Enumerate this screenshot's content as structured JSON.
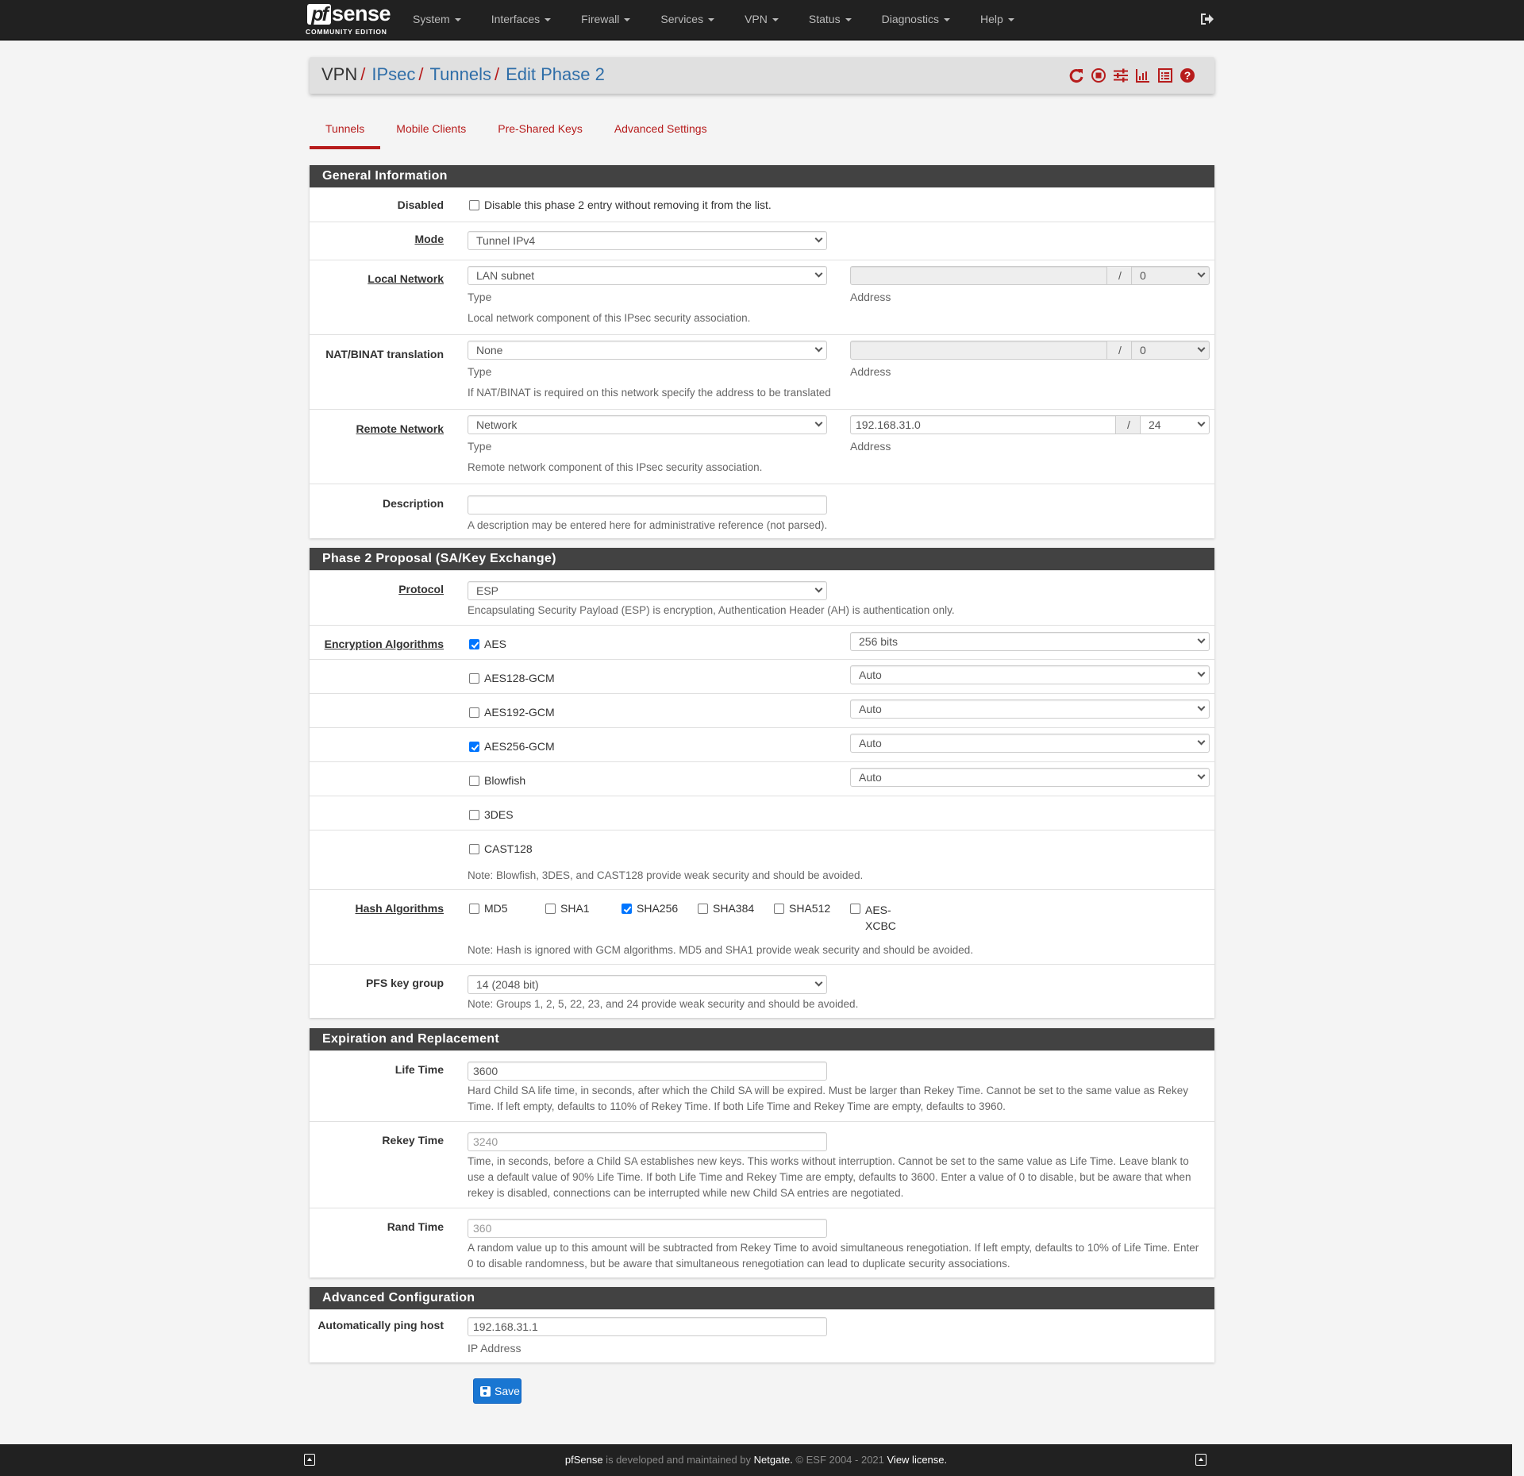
{
  "brand": {
    "logo_pf": "pf",
    "logo_sense": "sense",
    "edition": "COMMUNITY EDITION"
  },
  "nav": {
    "items": [
      {
        "label": "System"
      },
      {
        "label": "Interfaces"
      },
      {
        "label": "Firewall"
      },
      {
        "label": "Services"
      },
      {
        "label": "VPN"
      },
      {
        "label": "Status"
      },
      {
        "label": "Diagnostics"
      },
      {
        "label": "Help"
      }
    ],
    "logout_icon": "sign-out-icon"
  },
  "breadcrumb": {
    "items": [
      {
        "label": "VPN",
        "link": false
      },
      {
        "label": "IPsec",
        "link": true
      },
      {
        "label": "Tunnels",
        "link": true
      },
      {
        "label": "Edit Phase 2",
        "link": true
      }
    ],
    "separator": "/",
    "icons": [
      "refresh-icon",
      "stop-circle-icon",
      "sliders-icon",
      "bar-chart-icon",
      "list-icon",
      "help-circle-icon"
    ]
  },
  "tabs": [
    {
      "label": "Tunnels",
      "active": true
    },
    {
      "label": "Mobile Clients",
      "active": false
    },
    {
      "label": "Pre-Shared Keys",
      "active": false
    },
    {
      "label": "Advanced Settings",
      "active": false
    }
  ],
  "general": {
    "heading": "General Information",
    "disabled": {
      "label": "Disabled",
      "checked": false,
      "text": "Disable this phase 2 entry without removing it from the list."
    },
    "mode": {
      "label": "Mode",
      "value": "Tunnel IPv4"
    },
    "local_network": {
      "label": "Local Network",
      "type": "LAN subnet",
      "type_label": "Type",
      "address": "",
      "mask": "0",
      "address_label": "Address",
      "separator": "/",
      "help": "Local network component of this IPsec security association."
    },
    "nat": {
      "label": "NAT/BINAT translation",
      "type": "None",
      "type_label": "Type",
      "address": "",
      "mask": "0",
      "address_label": "Address",
      "separator": "/",
      "help": "If NAT/BINAT is required on this network specify the address to be translated"
    },
    "remote_network": {
      "label": "Remote Network",
      "type": "Network",
      "type_label": "Type",
      "address": "192.168.31.0",
      "mask": "24",
      "address_label": "Address",
      "separator": "/",
      "help": "Remote network component of this IPsec security association."
    },
    "description": {
      "label": "Description",
      "value": "",
      "help": "A description may be entered here for administrative reference (not parsed)."
    }
  },
  "phase2": {
    "heading": "Phase 2 Proposal (SA/Key Exchange)",
    "protocol": {
      "label": "Protocol",
      "value": "ESP",
      "help": "Encapsulating Security Payload (ESP) is encryption, Authentication Header (AH) is authentication only."
    },
    "encryption": {
      "label": "Encryption Algorithms",
      "algorithms": [
        {
          "name": "AES",
          "checked": true,
          "keylen": "256 bits"
        },
        {
          "name": "AES128-GCM",
          "checked": false,
          "keylen": "Auto"
        },
        {
          "name": "AES192-GCM",
          "checked": false,
          "keylen": "Auto"
        },
        {
          "name": "AES256-GCM",
          "checked": true,
          "keylen": "Auto"
        },
        {
          "name": "Blowfish",
          "checked": false,
          "keylen": "Auto"
        },
        {
          "name": "3DES",
          "checked": false,
          "keylen": null
        },
        {
          "name": "CAST128",
          "checked": false,
          "keylen": null
        }
      ],
      "note": "Note: Blowfish, 3DES, and CAST128 provide weak security and should be avoided."
    },
    "hash": {
      "label": "Hash Algorithms",
      "algorithms": [
        {
          "name": "MD5",
          "checked": false
        },
        {
          "name": "SHA1",
          "checked": false
        },
        {
          "name": "SHA256",
          "checked": true
        },
        {
          "name": "SHA384",
          "checked": false
        },
        {
          "name": "SHA512",
          "checked": false
        },
        {
          "name": "AES-XCBC",
          "checked": false,
          "line1": "AES-",
          "line2": "XCBC"
        }
      ],
      "note": "Note: Hash is ignored with GCM algorithms. MD5 and SHA1 provide weak security and should be avoided."
    },
    "pfs": {
      "label": "PFS key group",
      "value": "14 (2048 bit)",
      "note": "Note: Groups 1, 2, 5, 22, 23, and 24 provide weak security and should be avoided."
    }
  },
  "expiration": {
    "heading": "Expiration and Replacement",
    "life_time": {
      "label": "Life Time",
      "value": "3600",
      "help": "Hard Child SA life time, in seconds, after which the Child SA will be expired. Must be larger than Rekey Time. Cannot be set to the same value as Rekey Time. If left empty, defaults to 110% of Rekey Time. If both Life Time and Rekey Time are empty, defaults to 3960."
    },
    "rekey_time": {
      "label": "Rekey Time",
      "placeholder": "3240",
      "help": "Time, in seconds, before a Child SA establishes new keys. This works without interruption. Cannot be set to the same value as Life Time. Leave blank to use a default value of 90% Life Time. If both Life Time and Rekey Time are empty, defaults to 3600. Enter a value of 0 to disable, but be aware that when rekey is disabled, connections can be interrupted while new Child SA entries are negotiated."
    },
    "rand_time": {
      "label": "Rand Time",
      "placeholder": "360",
      "help": "A random value up to this amount will be subtracted from Rekey Time to avoid simultaneous renegotiation. If left empty, defaults to 10% of Life Time. Enter 0 to disable randomness, but be aware that simultaneous renegotiation can lead to duplicate security associations."
    }
  },
  "advanced": {
    "heading": "Advanced Configuration",
    "ping_host": {
      "label": "Automatically ping host",
      "value": "192.168.31.1",
      "sublabel": "IP Address"
    }
  },
  "save_button": {
    "label": "Save",
    "icon": "save-icon"
  },
  "footer": {
    "brand": "pfSense",
    "text1": " is developed and maintained by ",
    "company": "Netgate.",
    "text2": " © ESF 2004 - 2021 ",
    "license": "View license."
  },
  "colors": {
    "accent": "#b71c1c",
    "link": "#2f6ea8",
    "navbar": "#212121",
    "panel_heading": "#424242",
    "primary_button": "#1976d2"
  }
}
